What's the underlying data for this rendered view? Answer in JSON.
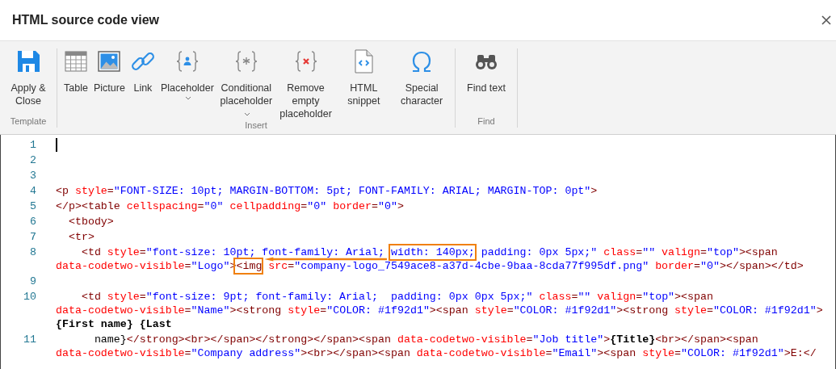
{
  "window": {
    "title": "HTML source code view"
  },
  "ribbon": {
    "groups": [
      {
        "label": "Template",
        "buttons": [
          {
            "kind": "save",
            "label": "Apply & Close",
            "has_menu": false
          }
        ]
      },
      {
        "label": "Insert",
        "buttons": [
          {
            "kind": "table",
            "label": "Table",
            "has_menu": false
          },
          {
            "kind": "picture",
            "label": "Picture",
            "has_menu": false
          },
          {
            "kind": "link",
            "label": "Link",
            "has_menu": false
          },
          {
            "kind": "placeholder",
            "label": "Placeholder",
            "has_menu": true
          },
          {
            "kind": "conditional",
            "label": "Conditional placeholder",
            "has_menu": true
          },
          {
            "kind": "remove",
            "label": "Remove empty placeholder",
            "has_menu": false
          },
          {
            "kind": "snippet",
            "label": "HTML snippet",
            "has_menu": false
          },
          {
            "kind": "special",
            "label": "Special character",
            "has_menu": false
          }
        ]
      },
      {
        "label": "Find",
        "buttons": [
          {
            "kind": "find",
            "label": "Find text",
            "has_menu": false
          }
        ]
      }
    ]
  },
  "editor": {
    "lines": [
      {
        "number": "1",
        "has_cursor": true,
        "rows": [
          {
            "segments": []
          }
        ]
      },
      {
        "number": "2",
        "has_cursor": false,
        "rows": [
          {
            "segments": []
          }
        ]
      },
      {
        "number": "3",
        "has_cursor": false,
        "rows": [
          {
            "segments": []
          }
        ]
      },
      {
        "number": "4",
        "has_cursor": false,
        "rows": [
          {
            "segments": [
              {
                "kind": "tag",
                "text": "<p"
              },
              {
                "kind": "attr",
                "text": " style"
              },
              {
                "kind": "tag",
                "text": "="
              },
              {
                "kind": "value",
                "text": "\"FONT-SIZE: 10pt; MARGIN-BOTTOM: 5pt; FONT-FAMILY: ARIAL; MARGIN-TOP: 0pt\""
              },
              {
                "kind": "tag",
                "text": ">"
              }
            ]
          }
        ]
      },
      {
        "number": "5",
        "has_cursor": false,
        "rows": [
          {
            "segments": [
              {
                "kind": "tag",
                "text": "</p><table"
              },
              {
                "kind": "attr",
                "text": " cellspacing"
              },
              {
                "kind": "tag",
                "text": "="
              },
              {
                "kind": "value",
                "text": "\"0\""
              },
              {
                "kind": "attr",
                "text": " cellpadding"
              },
              {
                "kind": "tag",
                "text": "="
              },
              {
                "kind": "value",
                "text": "\"0\""
              },
              {
                "kind": "attr",
                "text": " border"
              },
              {
                "kind": "tag",
                "text": "="
              },
              {
                "kind": "value",
                "text": "\"0\""
              },
              {
                "kind": "tag",
                "text": ">"
              }
            ]
          }
        ]
      },
      {
        "number": "6",
        "has_cursor": false,
        "rows": [
          {
            "segments": [
              {
                "kind": "tag",
                "text": "  <tbody>"
              }
            ]
          }
        ]
      },
      {
        "number": "7",
        "has_cursor": false,
        "rows": [
          {
            "segments": [
              {
                "kind": "tag",
                "text": "  <tr>"
              }
            ]
          }
        ]
      },
      {
        "number": "8",
        "has_cursor": false,
        "rows": [
          {
            "segments": [
              {
                "kind": "tag",
                "text": "    <td"
              },
              {
                "kind": "attr",
                "text": " style"
              },
              {
                "kind": "tag",
                "text": "="
              },
              {
                "kind": "value",
                "text": "\"font-size: 10pt; font-family: Arial; "
              },
              {
                "kind": "value",
                "text": "width: 140px;",
                "highlighted": true
              },
              {
                "kind": "value",
                "text": " padding: 0px 5px;\""
              },
              {
                "kind": "attr",
                "text": " class"
              },
              {
                "kind": "tag",
                "text": "="
              },
              {
                "kind": "value",
                "text": "\"\""
              },
              {
                "kind": "attr",
                "text": " valign"
              },
              {
                "kind": "tag",
                "text": "="
              },
              {
                "kind": "value",
                "text": "\"top\""
              },
              {
                "kind": "tag",
                "text": "><span"
              }
            ]
          },
          {
            "segments": [
              {
                "kind": "attr",
                "text": "data-codetwo-visible"
              },
              {
                "kind": "tag",
                "text": "="
              },
              {
                "kind": "value",
                "text": "\"Logo\""
              },
              {
                "kind": "tag",
                "text": ">"
              },
              {
                "kind": "tag",
                "text": "<img",
                "highlighted": true
              },
              {
                "kind": "attr",
                "text": " src"
              },
              {
                "kind": "tag",
                "text": "="
              },
              {
                "kind": "value",
                "text": "\"company-logo_7549ace8-a37d-4cbe-9baa-8cda77f995df.png\""
              },
              {
                "kind": "attr",
                "text": " border"
              },
              {
                "kind": "tag",
                "text": "="
              },
              {
                "kind": "value",
                "text": "\"0\""
              },
              {
                "kind": "tag",
                "text": "></span></td>"
              }
            ]
          }
        ]
      },
      {
        "number": "9",
        "has_cursor": false,
        "rows": [
          {
            "segments": []
          }
        ]
      },
      {
        "number": "10",
        "has_cursor": false,
        "rows": [
          {
            "segments": [
              {
                "kind": "tag",
                "text": "    <td"
              },
              {
                "kind": "attr",
                "text": " style"
              },
              {
                "kind": "tag",
                "text": "="
              },
              {
                "kind": "value",
                "text": "\"font-size: 9pt; font-family: Arial;  padding: 0px 0px 5px;\""
              },
              {
                "kind": "attr",
                "text": " class"
              },
              {
                "kind": "tag",
                "text": "="
              },
              {
                "kind": "value",
                "text": "\"\""
              },
              {
                "kind": "attr",
                "text": " valign"
              },
              {
                "kind": "tag",
                "text": "="
              },
              {
                "kind": "value",
                "text": "\"top\""
              },
              {
                "kind": "tag",
                "text": "><span"
              }
            ]
          },
          {
            "segments": [
              {
                "kind": "attr",
                "text": "data-codetwo-visible"
              },
              {
                "kind": "tag",
                "text": "="
              },
              {
                "kind": "value",
                "text": "\"Name\""
              },
              {
                "kind": "tag",
                "text": "><strong"
              },
              {
                "kind": "attr",
                "text": " style"
              },
              {
                "kind": "tag",
                "text": "="
              },
              {
                "kind": "value",
                "text": "\"COLOR: #1f92d1\""
              },
              {
                "kind": "tag",
                "text": "><span"
              },
              {
                "kind": "attr",
                "text": " style"
              },
              {
                "kind": "tag",
                "text": "="
              },
              {
                "kind": "value",
                "text": "\"COLOR: #1f92d1\""
              },
              {
                "kind": "tag",
                "text": "><strong"
              },
              {
                "kind": "attr",
                "text": " style"
              },
              {
                "kind": "tag",
                "text": "="
              },
              {
                "kind": "value",
                "text": "\"COLOR: #1f92d1\""
              },
              {
                "kind": "tag",
                "text": ">"
              }
            ]
          },
          {
            "segments": [
              {
                "kind": "bold",
                "text": "{First name} {Last"
              }
            ]
          }
        ]
      },
      {
        "number": "11",
        "has_cursor": false,
        "rows": [
          {
            "segments": [
              {
                "kind": "text",
                "text": "      name}"
              },
              {
                "kind": "tag",
                "text": "</strong><br></span></strong></span><span"
              },
              {
                "kind": "attr",
                "text": " data-codetwo-visible"
              },
              {
                "kind": "tag",
                "text": "="
              },
              {
                "kind": "value",
                "text": "\"Job title\""
              },
              {
                "kind": "tag",
                "text": ">"
              },
              {
                "kind": "bold",
                "text": "{Title}"
              },
              {
                "kind": "tag",
                "text": "<br></span><span"
              }
            ]
          },
          {
            "segments": [
              {
                "kind": "attr",
                "text": "data-codetwo-visible"
              },
              {
                "kind": "tag",
                "text": "="
              },
              {
                "kind": "value",
                "text": "\"Company address\""
              },
              {
                "kind": "tag",
                "text": "><br></span><span"
              },
              {
                "kind": "attr",
                "text": " data-codetwo-visible"
              },
              {
                "kind": "tag",
                "text": "="
              },
              {
                "kind": "value",
                "text": "\"Email\""
              },
              {
                "kind": "tag",
                "text": "><span"
              },
              {
                "kind": "attr",
                "text": " style"
              },
              {
                "kind": "tag",
                "text": "="
              },
              {
                "kind": "value",
                "text": "\"COLOR: #1f92d1\""
              },
              {
                "kind": "tag",
                "text": ">E:</"
              }
            ]
          }
        ]
      }
    ]
  }
}
